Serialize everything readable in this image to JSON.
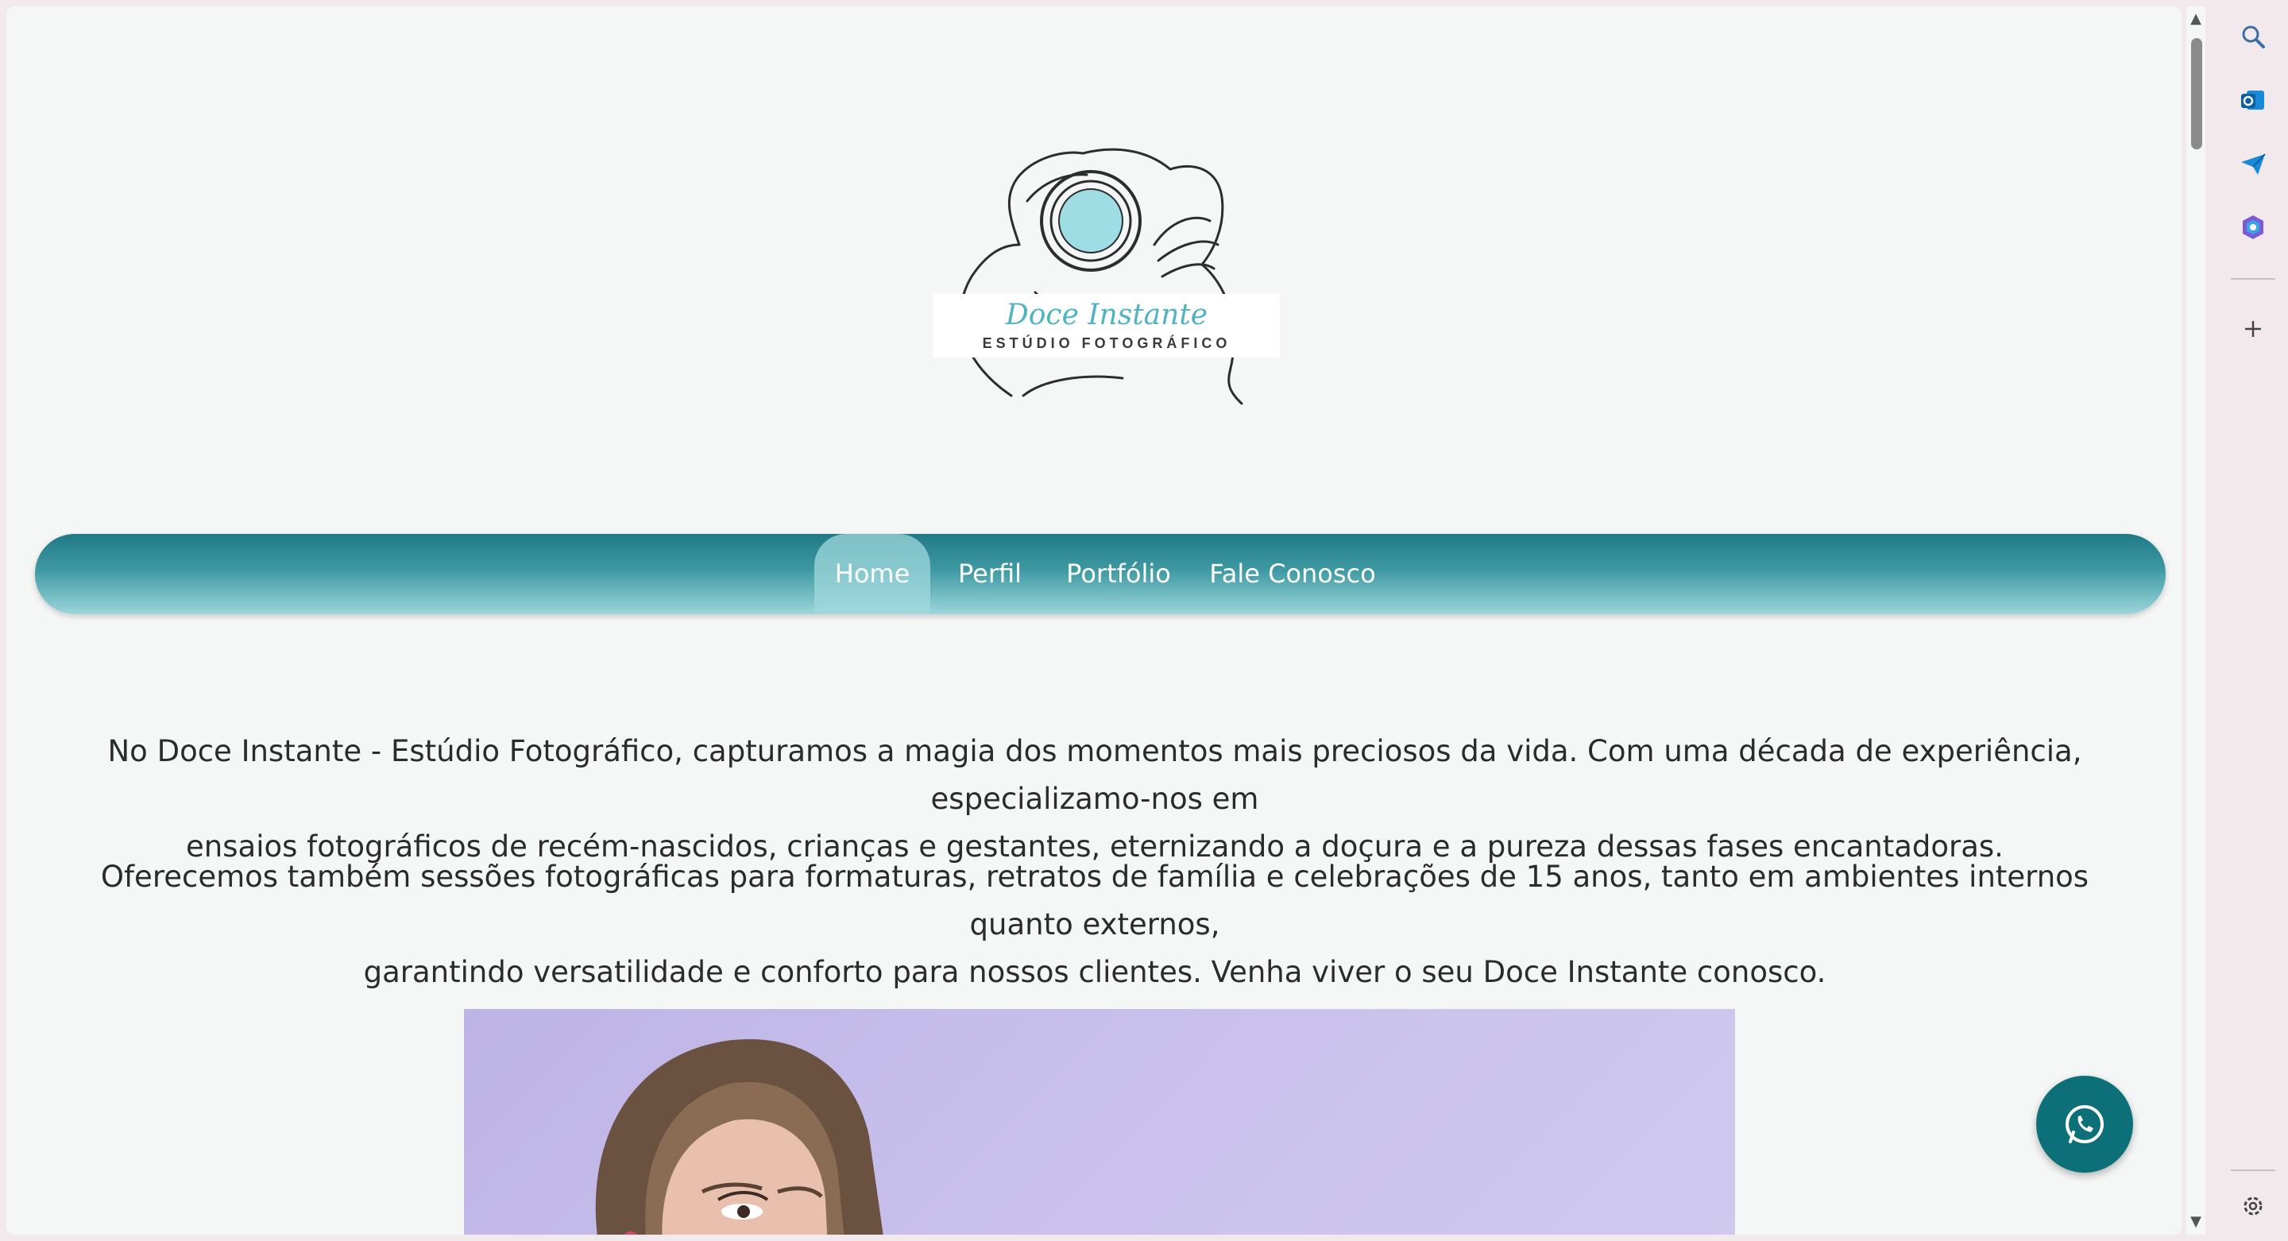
{
  "logo": {
    "script_text": "Doce Instante",
    "caption": "ESTÚDIO FOTOGRÁFICO"
  },
  "nav": {
    "items": [
      {
        "label": "Home",
        "active": true
      },
      {
        "label": "Perfil",
        "active": false
      },
      {
        "label": "Portfólio",
        "active": false
      },
      {
        "label": "Fale Conosco",
        "active": false
      }
    ]
  },
  "intro": {
    "p1_line1": "No Doce Instante - Estúdio Fotográfico, capturamos a magia dos momentos mais preciosos da vida. Com uma década de experiência, especializamo-nos em",
    "p1_line2": "ensaios fotográficos de recém-nascidos, crianças e gestantes, eternizando a doçura e a pureza dessas fases encantadoras.",
    "p2_line1": "Oferecemos também sessões fotográficas para formaturas, retratos de família e celebrações de 15 anos, tanto em ambientes internos quanto externos,",
    "p2_line2": "garantindo versatilidade e conforto para nossos clientes. Venha viver o seu Doce Instante conosco."
  },
  "floating": {
    "whatsapp_icon": "whatsapp-icon"
  },
  "sidebar": {
    "icons": [
      "search-icon",
      "outlook-icon",
      "send-icon",
      "copilot-icon",
      "plus-icon",
      "settings-icon"
    ]
  },
  "colors": {
    "nav_dark": "#1f7a85",
    "nav_light": "#9dd6db",
    "whatsapp_bg": "#0d6f77",
    "hero_bg": "#c9c1ec",
    "page_bg": "#f5f7f6"
  }
}
